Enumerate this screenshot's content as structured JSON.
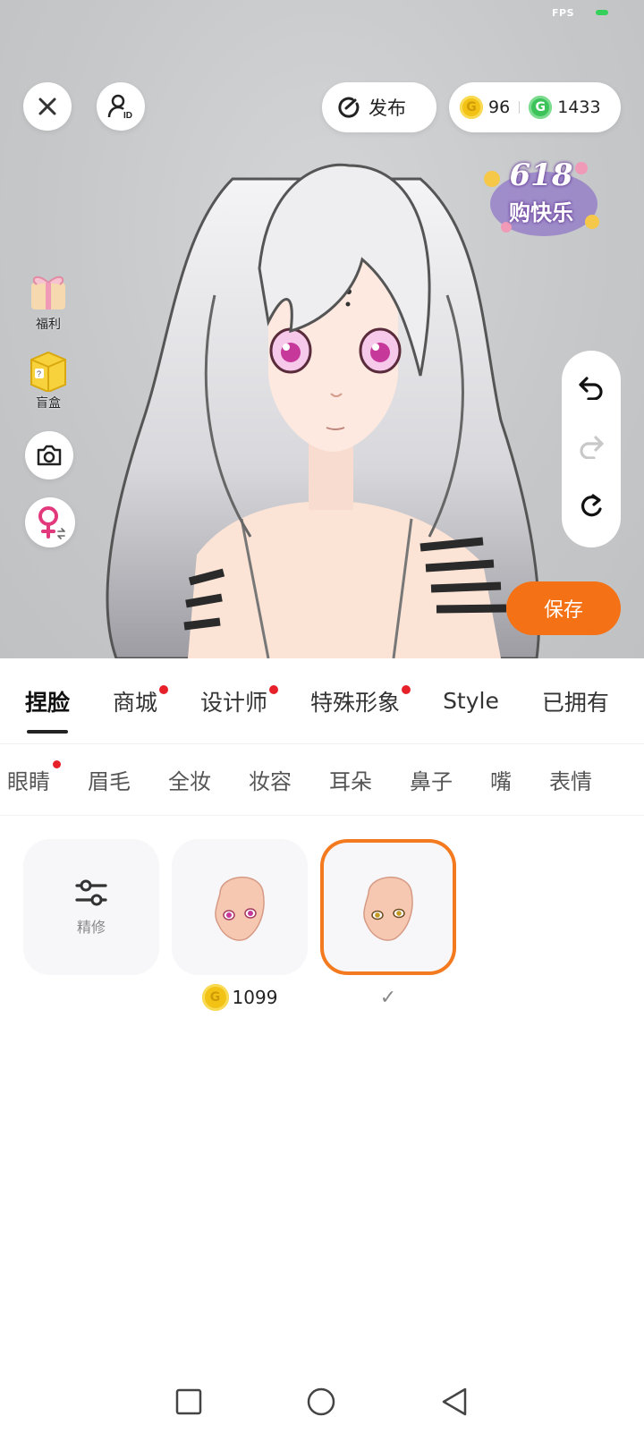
{
  "status": {
    "fps_label": "FPS"
  },
  "header": {
    "publish_label": "发布",
    "gold_coins": "96",
    "green_coins": "1433"
  },
  "promo": {
    "line1": "618",
    "line2": "购快乐"
  },
  "side_menu": [
    {
      "label": "福利",
      "icon": "gift-bow-icon"
    },
    {
      "label": "盲盒",
      "icon": "mystery-box-icon"
    }
  ],
  "save_label": "保存",
  "tabs": [
    {
      "label": "捏脸",
      "active": true,
      "dot": false
    },
    {
      "label": "商城",
      "active": false,
      "dot": true
    },
    {
      "label": "设计师",
      "active": false,
      "dot": true
    },
    {
      "label": "特殊形象",
      "active": false,
      "dot": true
    },
    {
      "label": "Style",
      "active": false,
      "dot": false
    },
    {
      "label": "已拥有",
      "active": false,
      "dot": false
    }
  ],
  "subtabs": [
    {
      "label": "眼睛",
      "dot": true
    },
    {
      "label": "眉毛",
      "dot": false
    },
    {
      "label": "全妆",
      "dot": false
    },
    {
      "label": "妆容",
      "dot": false
    },
    {
      "label": "耳朵",
      "dot": false
    },
    {
      "label": "鼻子",
      "dot": false
    },
    {
      "label": "嘴",
      "dot": false
    },
    {
      "label": "表情",
      "dot": false
    }
  ],
  "items": {
    "refine_label": "精修",
    "item1_price": "1099",
    "selected_check": "✓"
  },
  "colors": {
    "accent": "#f47115",
    "dot": "#e6212a",
    "gold": "#f2c215",
    "green": "#3cc45a"
  }
}
